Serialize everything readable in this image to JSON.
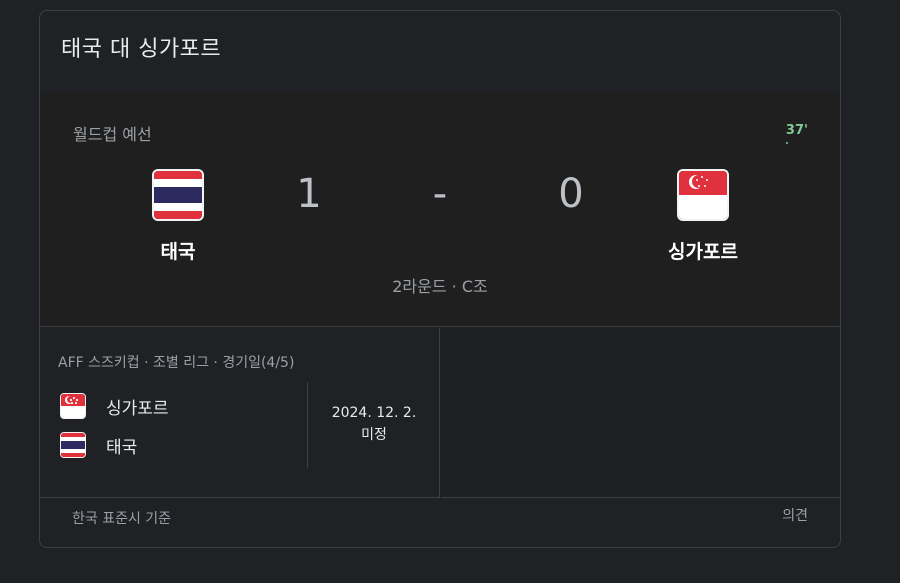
{
  "card": {
    "title": "태국 대 싱가포르"
  },
  "match": {
    "competition": "월드컵 예선",
    "live_minute": "37'",
    "home": {
      "name": "태국",
      "score": "1",
      "flag": "thailand-flag-icon"
    },
    "away": {
      "name": "싱가포르",
      "score": "0",
      "flag": "singapore-flag-icon"
    },
    "separator": "-",
    "round": "2라운드 · C조"
  },
  "upcoming": {
    "competition": "AFF 스즈키컵 · 조별 리그 · 경기일(4/5)",
    "team1": "싱가포르",
    "team2": "태국",
    "date": "2024. 12. 2.",
    "status": "미정"
  },
  "footer": {
    "timezone": "한국 표준시 기준",
    "feedback": "의견"
  },
  "colors": {
    "background": "#202124",
    "live_green": "#81c995",
    "flag_red": "#e0313c",
    "flag_blue": "#2d2a5f"
  }
}
